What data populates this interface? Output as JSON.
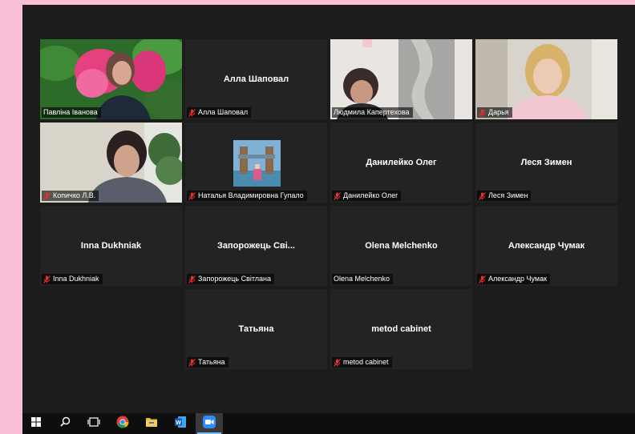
{
  "participants": [
    {
      "name": "Павліна Іванова",
      "display": "",
      "muted": false,
      "video": "flower",
      "active": true
    },
    {
      "name": "Алла Шаповал",
      "display": "Алла Шаповал",
      "muted": true,
      "video": "none",
      "active": false
    },
    {
      "name": "Людмила Капертехова",
      "display": "",
      "muted": false,
      "video": "woman-dark",
      "active": false
    },
    {
      "name": "Дарья",
      "display": "",
      "muted": true,
      "video": "woman-blonde",
      "active": false
    },
    {
      "name": "Копичко Л.В.",
      "display": "",
      "muted": true,
      "video": "woman-office",
      "active": false
    },
    {
      "name": "Наталья Владимировна Гупало",
      "display": "",
      "muted": true,
      "video": "photo",
      "active": false
    },
    {
      "name": "Данилейко Олег",
      "display": "Данилейко Олег",
      "muted": true,
      "video": "none",
      "active": false
    },
    {
      "name": "Леся Зимен",
      "display": "Леся Зимен",
      "muted": true,
      "video": "none",
      "active": false
    },
    {
      "name": "Inna Dukhniak",
      "display": "Inna Dukhniak",
      "muted": true,
      "video": "none",
      "active": false
    },
    {
      "name": "Запорожець Світлана",
      "display": "Запорожець  Сві...",
      "muted": true,
      "video": "none",
      "active": false
    },
    {
      "name": "Olena Melchenko",
      "display": "Olena Melchenko",
      "muted": false,
      "video": "none",
      "active": false
    },
    {
      "name": "Александр Чумак",
      "display": "Александр Чумак",
      "muted": true,
      "video": "none",
      "active": false
    },
    {
      "name": "Татьяна",
      "display": "Татьяна",
      "muted": true,
      "video": "none",
      "active": false
    },
    {
      "name": "metod cabinet",
      "display": "metod cabinet",
      "muted": true,
      "video": "none",
      "active": false
    }
  ],
  "taskbar": {
    "items": [
      {
        "icon": "windows-start-icon"
      },
      {
        "icon": "search-icon"
      },
      {
        "icon": "task-view-icon"
      },
      {
        "icon": "chrome-icon"
      },
      {
        "icon": "file-explorer-icon"
      },
      {
        "icon": "word-icon"
      },
      {
        "icon": "zoom-icon",
        "running": true
      }
    ]
  },
  "colors": {
    "active_speaker_border": "#d9e04a",
    "muted_mic": "#e0332e",
    "desktop_background": "#f8bfd6"
  }
}
